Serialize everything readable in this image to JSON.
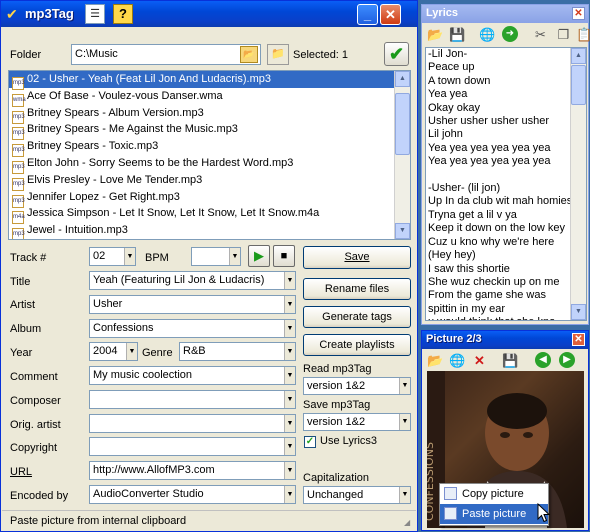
{
  "main_window": {
    "title": "mp3Tag",
    "folder_label": "Folder",
    "folder_value": "C:\\Music",
    "selected_text": "Selected: 1",
    "files": [
      "02 - Usher - Yeah (Feat Lil Jon And Ludacris).mp3",
      "Ace Of Base - Voulez-vous Danser.wma",
      "Britney Spears - Album Version.mp3",
      "Britney Spears - Me Against the Music.mp3",
      "Britney Spears - Toxic.mp3",
      "Elton John - Sorry Seems to be the Hardest Word.mp3",
      "Elvis Presley - Love Me Tender.mp3",
      "Jennifer Lopez - Get Right.mp3",
      "Jessica Simpson - Let It Snow, Let It Snow, Let It Snow.m4a",
      "Jewel - Intuition.mp3"
    ],
    "file_icons": [
      "mp3",
      "wma",
      "mp3",
      "mp3",
      "mp3",
      "mp3",
      "mp3",
      "mp3",
      "m4a",
      "mp3"
    ],
    "selected_index": 0,
    "fields": {
      "track_label": "Track #",
      "track_value": "02",
      "bpm_label": "BPM",
      "bpm_value": "",
      "title_label": "Title",
      "title_value": "Yeah (Featuring Lil Jon & Ludacris)",
      "artist_label": "Artist",
      "artist_value": "Usher",
      "album_label": "Album",
      "album_value": "Confessions",
      "year_label": "Year",
      "year_value": "2004",
      "genre_label": "Genre",
      "genre_value": "R&B",
      "comment_label": "Comment",
      "comment_value": "My music coolection",
      "composer_label": "Composer",
      "composer_value": "",
      "orig_artist_label": "Orig. artist",
      "orig_artist_value": "",
      "copyright_label": "Copyright",
      "copyright_value": "",
      "url_label": "URL",
      "url_value": "http://www.AllofMP3.com",
      "encoded_label": "Encoded by",
      "encoded_value": "AudioConverter Studio"
    },
    "buttons": {
      "save": "Save",
      "rename": "Rename files",
      "generate": "Generate tags",
      "playlists": "Create playlists"
    },
    "read_label": "Read mp3Tag",
    "read_value": "version 1&2",
    "save_label": "Save mp3Tag",
    "save_value": "version 1&2",
    "use_lyrics_label": "Use Lyrics3",
    "use_lyrics_checked": true,
    "cap_label": "Capitalization",
    "cap_value": "Unchanged",
    "status": "Paste picture from internal clipboard"
  },
  "lyrics_window": {
    "title": "Lyrics",
    "lines": [
      "-Lil Jon-",
      "Peace up",
      "A town down",
      "Yea yea",
      "Okay okay",
      "Usher usher usher usher",
      "Lil john",
      "Yea yea yea yea yea yea",
      "Yea yea yea yea yea yea",
      "",
      "-Usher- (lil jon)",
      "Up In da club wit mah homies",
      "Tryna get a lil v ya",
      "Keep it down on the low key",
      "Cuz u kno why we're here",
      "(Hey hey)",
      "I saw this shortie",
      "She wuz checkin up on me",
      "From the game she was",
      "spittin in my ear",
      "u would think that she kno"
    ]
  },
  "picture_window": {
    "title": "Picture 2/3",
    "context_menu": [
      "Copy picture",
      "Paste picture"
    ],
    "highlighted_index": 1
  },
  "colors": {
    "xp_title": "#0a5ef6",
    "selection": "#316ac5",
    "window_face": "#ece9d8"
  }
}
